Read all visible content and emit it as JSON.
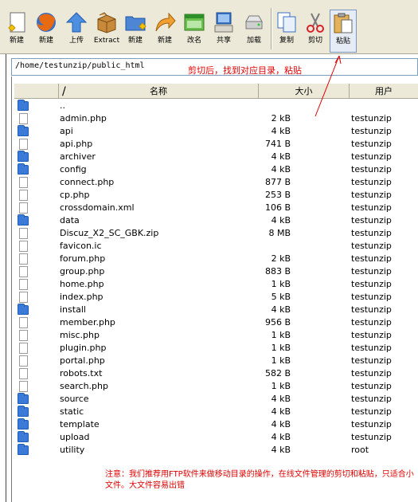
{
  "toolbar": {
    "buttons": [
      {
        "label": "新建",
        "icon": "new-file-icon"
      },
      {
        "label": "新建",
        "icon": "firefox-icon"
      },
      {
        "label": "上传",
        "icon": "upload-arrow-icon"
      },
      {
        "label": "Extract",
        "icon": "extract-box-icon"
      },
      {
        "label": "新建",
        "icon": "new-folder-icon"
      },
      {
        "label": "新建",
        "icon": "new-link-arrow-icon"
      },
      {
        "label": "改名",
        "icon": "rename-window-icon"
      },
      {
        "label": "共享",
        "icon": "share-computer-icon"
      },
      {
        "label": "加载",
        "icon": "load-drive-icon"
      },
      {
        "label": "复制",
        "icon": "copy-icon"
      },
      {
        "label": "剪切",
        "icon": "scissors-icon"
      },
      {
        "label": "粘贴",
        "icon": "paste-clipboard-icon"
      }
    ]
  },
  "path": "/home/testunzip/public_html",
  "annotation_top": "剪切后，找到对应目录，粘贴",
  "annotation_bottom": "注意：我们推荐用FTP软件来做移动目录的操作，在线文件管理的剪切和粘贴，只适合小文件。大文件容易出错",
  "columns": {
    "sort": "/",
    "name": "名称",
    "size": "大小",
    "user": "用户"
  },
  "files": [
    {
      "name": "..",
      "size": "",
      "user": "",
      "type": "folder"
    },
    {
      "name": "admin.php",
      "size": "2 kB",
      "user": "testunzip",
      "type": "file"
    },
    {
      "name": "api",
      "size": "4 kB",
      "user": "testunzip",
      "type": "folder"
    },
    {
      "name": "api.php",
      "size": "741 B",
      "user": "testunzip",
      "type": "file"
    },
    {
      "name": "archiver",
      "size": "4 kB",
      "user": "testunzip",
      "type": "folder"
    },
    {
      "name": "config",
      "size": "4 kB",
      "user": "testunzip",
      "type": "folder"
    },
    {
      "name": "connect.php",
      "size": "877 B",
      "user": "testunzip",
      "type": "file"
    },
    {
      "name": "cp.php",
      "size": "253 B",
      "user": "testunzip",
      "type": "file"
    },
    {
      "name": "crossdomain.xml",
      "size": "106 B",
      "user": "testunzip",
      "type": "file"
    },
    {
      "name": "data",
      "size": "4 kB",
      "user": "testunzip",
      "type": "folder"
    },
    {
      "name": "Discuz_X2_SC_GBK.zip",
      "size": "8 MB",
      "user": "testunzip",
      "type": "file"
    },
    {
      "name": "favicon.ic",
      "size": "",
      "user": "testunzip",
      "type": "file"
    },
    {
      "name": "forum.php",
      "size": "2 kB",
      "user": "testunzip",
      "type": "file"
    },
    {
      "name": "group.php",
      "size": "883 B",
      "user": "testunzip",
      "type": "file"
    },
    {
      "name": "home.php",
      "size": "1 kB",
      "user": "testunzip",
      "type": "file"
    },
    {
      "name": "index.php",
      "size": "5 kB",
      "user": "testunzip",
      "type": "file"
    },
    {
      "name": "install",
      "size": "4 kB",
      "user": "testunzip",
      "type": "folder"
    },
    {
      "name": "member.php",
      "size": "956 B",
      "user": "testunzip",
      "type": "file"
    },
    {
      "name": "misc.php",
      "size": "1 kB",
      "user": "testunzip",
      "type": "file"
    },
    {
      "name": "plugin.php",
      "size": "1 kB",
      "user": "testunzip",
      "type": "file"
    },
    {
      "name": "portal.php",
      "size": "1 kB",
      "user": "testunzip",
      "type": "file"
    },
    {
      "name": "robots.txt",
      "size": "582 B",
      "user": "testunzip",
      "type": "file"
    },
    {
      "name": "search.php",
      "size": "1 kB",
      "user": "testunzip",
      "type": "file"
    },
    {
      "name": "source",
      "size": "4 kB",
      "user": "testunzip",
      "type": "folder"
    },
    {
      "name": "static",
      "size": "4 kB",
      "user": "testunzip",
      "type": "folder"
    },
    {
      "name": "template",
      "size": "4 kB",
      "user": "testunzip",
      "type": "folder"
    },
    {
      "name": "upload",
      "size": "4 kB",
      "user": "testunzip",
      "type": "folder"
    },
    {
      "name": "utility",
      "size": "4 kB",
      "user": "root",
      "type": "folder"
    }
  ],
  "colors": {
    "annotation": "#e00000",
    "folder": "#3b7ad6",
    "toolbar_bg": "#ece9d8"
  }
}
